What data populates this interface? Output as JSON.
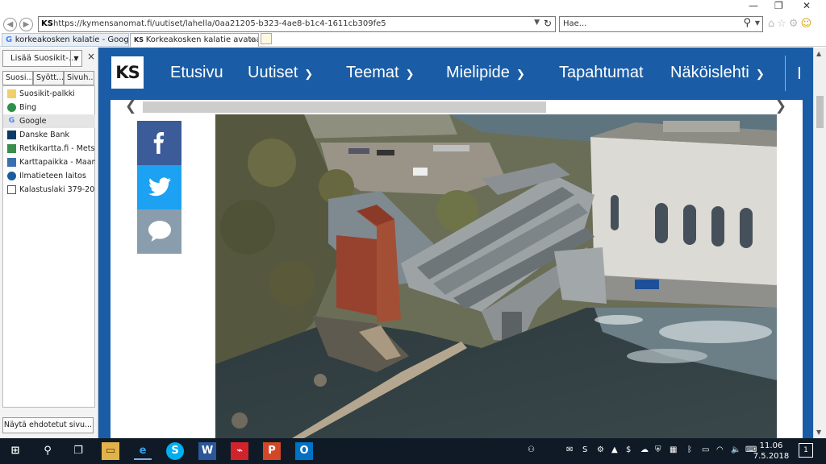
{
  "browser": {
    "url": "https://kymensanomat.fi/uutiset/lahella/0aa21205-b323-4ae8-b1c4-1611cb309fe5",
    "site_badge": "KS",
    "search_placeholder": "Hae...",
    "tabs": [
      {
        "label": "korkeakosken kalatie - Google-..."
      },
      {
        "label": "Korkeakosken kalatie avataan...",
        "close": "×"
      }
    ]
  },
  "sidebar": {
    "add_favorites": "Lisää Suosikit-...",
    "close": "×",
    "tabs": [
      "Suosi...",
      "Syött...",
      "Sivuh..."
    ],
    "favorites": [
      {
        "label": "Suosikit-palkki",
        "icon": "folder-icon"
      },
      {
        "label": "Bing",
        "icon": "globe-icon"
      },
      {
        "label": "Google",
        "icon": "google-icon"
      },
      {
        "label": "Danske Bank",
        "icon": "bank-icon"
      },
      {
        "label": "Retkikartta.fi - Metsä...",
        "icon": "map-icon"
      },
      {
        "label": "Karttapaikka - Maan...",
        "icon": "map-icon"
      },
      {
        "label": "Ilmatieteen laitos",
        "icon": "weather-icon"
      },
      {
        "label": "Kalastuslaki 379-201...",
        "icon": "document-icon"
      }
    ],
    "suggest_button": "Näytä ehdotetut sivu..."
  },
  "site": {
    "logo": "KS",
    "nav": [
      {
        "label": "Etusivu",
        "chevron": false
      },
      {
        "label": "Uutiset",
        "chevron": true
      },
      {
        "label": "Teemat",
        "chevron": true
      },
      {
        "label": "Mielipide",
        "chevron": true
      },
      {
        "label": "Tapahtumat",
        "chevron": false
      },
      {
        "label": "Näköislehti",
        "chevron": true
      }
    ],
    "nav_overflow": "I",
    "brand_color": "#1a5da6"
  },
  "share": {
    "facebook": "facebook-icon",
    "twitter": "twitter-icon",
    "comment": "comment-icon"
  },
  "taskbar": {
    "time": "11.06",
    "date": "7.5.2018",
    "notifications": "1"
  }
}
